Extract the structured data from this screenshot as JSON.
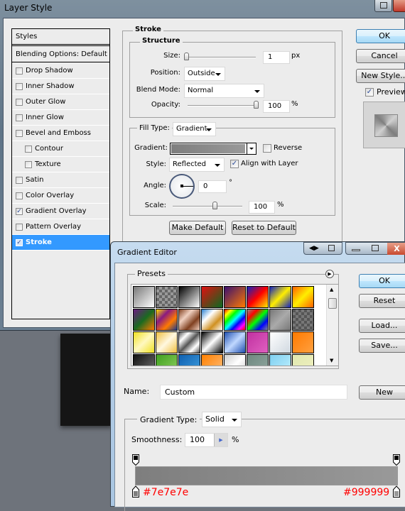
{
  "layer_style": {
    "title": "Layer Style",
    "styles_header": "Styles",
    "blending_options": "Blending Options: Default",
    "style_items": [
      {
        "label": "Drop Shadow",
        "checked": false,
        "sub": false
      },
      {
        "label": "Inner Shadow",
        "checked": false,
        "sub": false
      },
      {
        "label": "Outer Glow",
        "checked": false,
        "sub": false
      },
      {
        "label": "Inner Glow",
        "checked": false,
        "sub": false
      },
      {
        "label": "Bevel and Emboss",
        "checked": false,
        "sub": false
      },
      {
        "label": "Contour",
        "checked": false,
        "sub": true
      },
      {
        "label": "Texture",
        "checked": false,
        "sub": true
      },
      {
        "label": "Satin",
        "checked": false,
        "sub": false
      },
      {
        "label": "Color Overlay",
        "checked": false,
        "sub": false
      },
      {
        "label": "Gradient Overlay",
        "checked": true,
        "sub": false
      },
      {
        "label": "Pattern Overlay",
        "checked": false,
        "sub": false
      },
      {
        "label": "Stroke",
        "checked": true,
        "sub": false,
        "selected": true
      }
    ],
    "stroke": {
      "group_label": "Stroke",
      "structure_label": "Structure",
      "size_label": "Size:",
      "size_value": "1",
      "size_unit": "px",
      "position_label": "Position:",
      "position_value": "Outside",
      "blend_mode_label": "Blend Mode:",
      "blend_mode_value": "Normal",
      "opacity_label": "Opacity:",
      "opacity_value": "100",
      "opacity_unit": "%",
      "fill_type_label": "Fill Type:",
      "fill_type_value": "Gradient",
      "gradient_label": "Gradient:",
      "reverse_label": "Reverse",
      "reverse_checked": false,
      "style_label": "Style:",
      "style_value": "Reflected",
      "align_label": "Align with Layer",
      "align_checked": true,
      "angle_label": "Angle:",
      "angle_value": "0",
      "angle_unit": "°",
      "scale_label": "Scale:",
      "scale_value": "100",
      "scale_unit": "%",
      "make_default": "Make Default",
      "reset_default": "Reset to Default"
    },
    "buttons": {
      "ok": "OK",
      "cancel": "Cancel",
      "new_style": "New Style...",
      "preview": "Preview",
      "preview_checked": true
    }
  },
  "gradient_editor": {
    "title": "Gradient Editor",
    "presets_label": "Presets",
    "buttons": {
      "ok": "OK",
      "reset": "Reset",
      "load": "Load...",
      "save": "Save...",
      "new": "New"
    },
    "name_label": "Name:",
    "name_value": "Custom",
    "gradient_type_label": "Gradient Type:",
    "gradient_type_value": "Solid",
    "smoothness_label": "Smoothness:",
    "smoothness_value": "100",
    "smoothness_unit": "%",
    "stops": {
      "left_color": "#7e7e7e",
      "right_color": "#999999"
    },
    "annotations": {
      "left": "#7e7e7e",
      "right": "#999999"
    }
  }
}
